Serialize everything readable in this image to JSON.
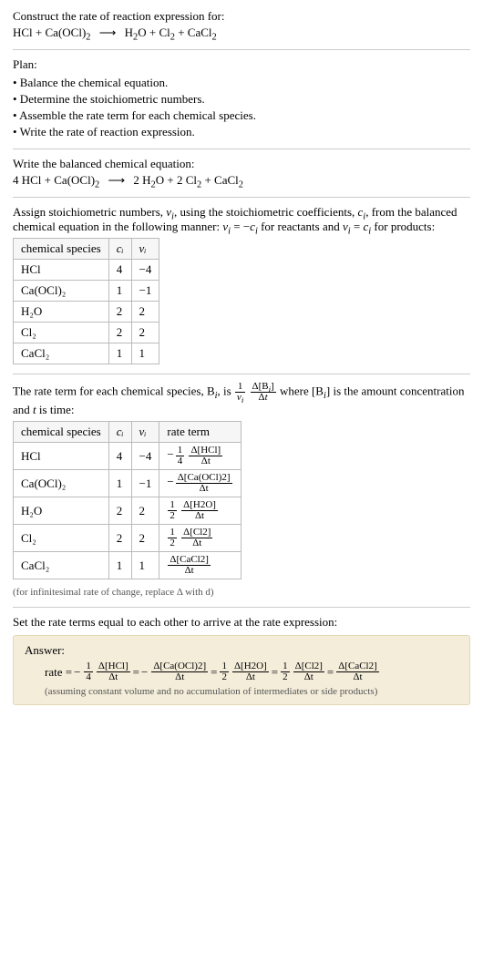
{
  "construct": {
    "title": "Construct the rate of reaction expression for:",
    "eq_lhs": "HCl + Ca(OCl)",
    "eq_lhs_sub": "2",
    "eq_rhs_1": "H",
    "eq_rhs_1_sub": "2",
    "eq_rhs_1_tail": "O + Cl",
    "eq_rhs_2_sub": "2",
    "eq_rhs_2_tail": " + CaCl",
    "eq_rhs_3_sub": "2",
    "arrow": "⟶"
  },
  "plan": {
    "title": "Plan:",
    "bullets": [
      "• Balance the chemical equation.",
      "• Determine the stoichiometric numbers.",
      "• Assemble the rate term for each chemical species.",
      "• Write the rate of reaction expression."
    ]
  },
  "balanced": {
    "title": "Write the balanced chemical equation:",
    "lhs": "4 HCl + Ca(OCl)",
    "lhs_sub": "2",
    "rhs_1": "2 H",
    "rhs_1_sub": "2",
    "rhs_1_tail": "O + 2 Cl",
    "rhs_2_sub": "2",
    "rhs_2_tail": " + CaCl",
    "rhs_3_sub": "2",
    "arrow": "⟶"
  },
  "assign": {
    "text_1": "Assign stoichiometric numbers, ",
    "nu_i": "ν",
    "nu_i_sub": "i",
    "text_2": ", using the stoichiometric coefficients, ",
    "c_i": "c",
    "c_i_sub": "i",
    "text_3": ", from the balanced chemical equation in the following manner: ",
    "eq1_a": "ν",
    "eq1_b": " = −",
    "eq1_c": "c",
    "text_4": " for reactants and ",
    "eq2_a": "ν",
    "eq2_b": " = ",
    "eq2_c": "c",
    "text_5": " for products:"
  },
  "table1": {
    "headers": [
      "chemical species",
      "cᵢ",
      "νᵢ"
    ],
    "rows": [
      {
        "species": "HCl",
        "c": "4",
        "nu": "−4"
      },
      {
        "species": "Ca(OCl)₂",
        "c": "1",
        "nu": "−1"
      },
      {
        "species": "H₂O",
        "c": "2",
        "nu": "2"
      },
      {
        "species": "Cl₂",
        "c": "2",
        "nu": "2"
      },
      {
        "species": "CaCl₂",
        "c": "1",
        "nu": "1"
      }
    ]
  },
  "rateterm": {
    "text_1": "The rate term for each chemical species, B",
    "sub_i": "i",
    "text_2": ", is ",
    "one": "1",
    "nu": "ν",
    "delta_b": "Δ[B",
    "close": "]",
    "delta_t": "Δt",
    "text_3": " where [B",
    "text_4": "] is the amount concentration and ",
    "t": "t",
    "text_5": " is time:"
  },
  "table2": {
    "headers": [
      "chemical species",
      "cᵢ",
      "νᵢ",
      "rate term"
    ],
    "rows": [
      {
        "species": "HCl",
        "c": "4",
        "nu": "−4",
        "sign": "−",
        "coef_num": "1",
        "coef_den": "4",
        "conc": "Δ[HCl]",
        "dt": "Δt"
      },
      {
        "species": "Ca(OCl)₂",
        "c": "1",
        "nu": "−1",
        "sign": "−",
        "coef_num": "",
        "coef_den": "",
        "conc": "Δ[Ca(OCl)2]",
        "dt": "Δt"
      },
      {
        "species": "H₂O",
        "c": "2",
        "nu": "2",
        "sign": "",
        "coef_num": "1",
        "coef_den": "2",
        "conc": "Δ[H2O]",
        "dt": "Δt"
      },
      {
        "species": "Cl₂",
        "c": "2",
        "nu": "2",
        "sign": "",
        "coef_num": "1",
        "coef_den": "2",
        "conc": "Δ[Cl2]",
        "dt": "Δt"
      },
      {
        "species": "CaCl₂",
        "c": "1",
        "nu": "1",
        "sign": "",
        "coef_num": "",
        "coef_den": "",
        "conc": "Δ[CaCl2]",
        "dt": "Δt"
      }
    ],
    "note": "(for infinitesimal rate of change, replace Δ with d)"
  },
  "setterms": {
    "text": "Set the rate terms equal to each other to arrive at the rate expression:"
  },
  "answer": {
    "label": "Answer:",
    "rate": "rate = ",
    "eq": " = ",
    "neg": "−",
    "one": "1",
    "four": "4",
    "two": "2",
    "hcl_num": "Δ[HCl]",
    "caocl_num": "Δ[Ca(OCl)2]",
    "h2o_num": "Δ[H2O]",
    "cl2_num": "Δ[Cl2]",
    "cacl2_num": "Δ[CaCl2]",
    "dt": "Δt",
    "note": "(assuming constant volume and no accumulation of intermediates or side products)"
  },
  "chart_data": {
    "type": "table",
    "title": "Stoichiometric numbers and rate terms",
    "tables": [
      {
        "columns": [
          "chemical species",
          "c_i",
          "nu_i"
        ],
        "rows": [
          [
            "HCl",
            4,
            -4
          ],
          [
            "Ca(OCl)2",
            1,
            -1
          ],
          [
            "H2O",
            2,
            2
          ],
          [
            "Cl2",
            2,
            2
          ],
          [
            "CaCl2",
            1,
            1
          ]
        ]
      },
      {
        "columns": [
          "chemical species",
          "c_i",
          "nu_i",
          "rate term"
        ],
        "rows": [
          [
            "HCl",
            4,
            -4,
            "-(1/4) d[HCl]/dt"
          ],
          [
            "Ca(OCl)2",
            1,
            -1,
            "- d[Ca(OCl)2]/dt"
          ],
          [
            "H2O",
            2,
            2,
            "(1/2) d[H2O]/dt"
          ],
          [
            "Cl2",
            2,
            2,
            "(1/2) d[Cl2]/dt"
          ],
          [
            "CaCl2",
            1,
            1,
            "d[CaCl2]/dt"
          ]
        ]
      }
    ],
    "balanced_equation": "4 HCl + Ca(OCl)2 -> 2 H2O + 2 Cl2 + CaCl2",
    "rate_expression": "rate = -(1/4) d[HCl]/dt = - d[Ca(OCl)2]/dt = (1/2) d[H2O]/dt = (1/2) d[Cl2]/dt = d[CaCl2]/dt"
  }
}
